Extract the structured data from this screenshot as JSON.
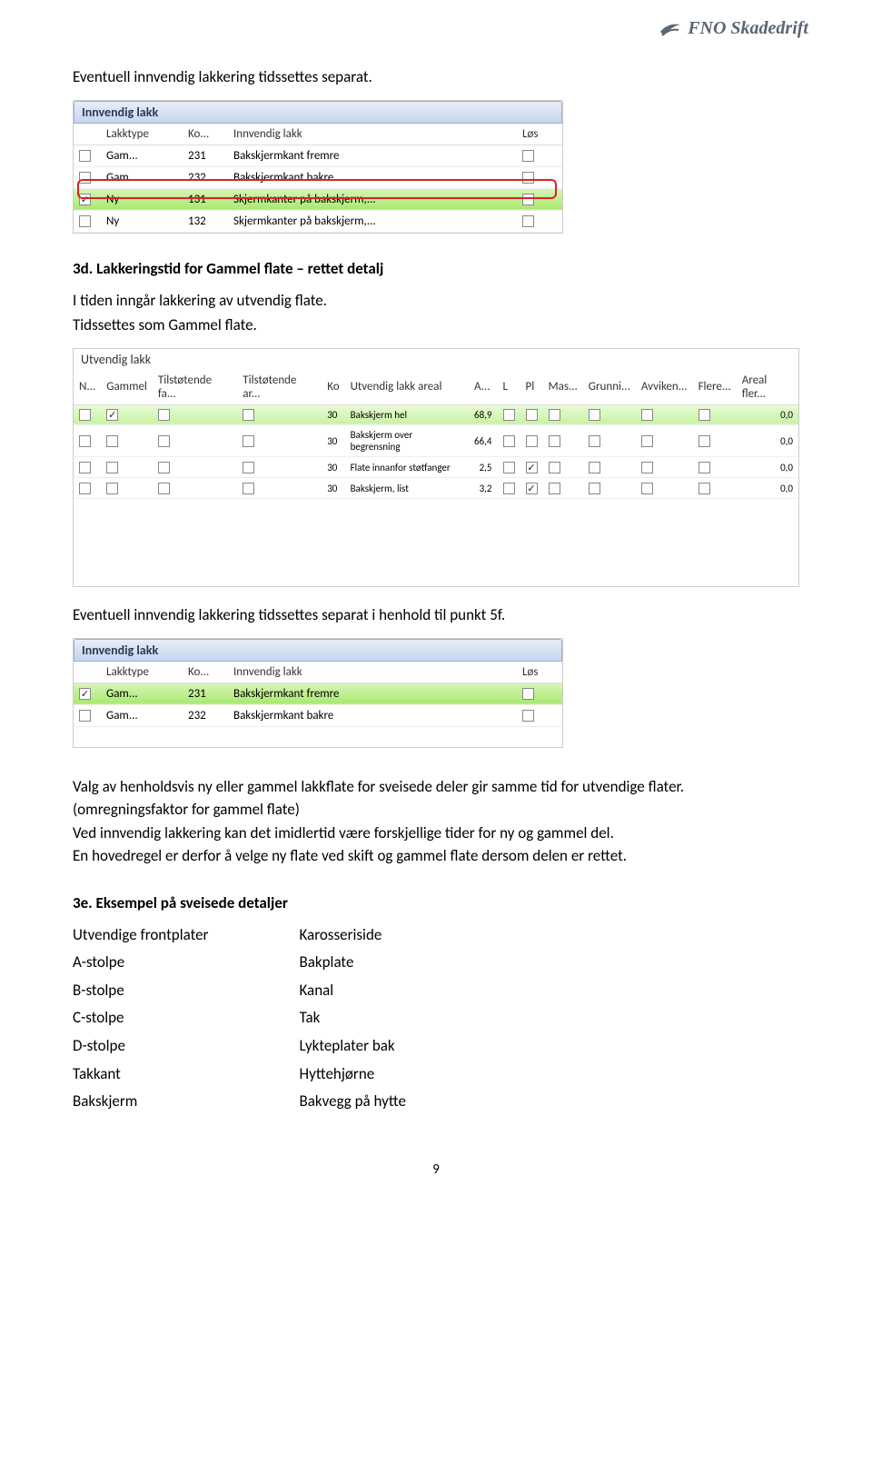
{
  "logo_text": "FNO Skadedrift",
  "intro": "Eventuell innvendig lakkering tidssettes separat.",
  "table1": {
    "title": "Innvendig lakk",
    "headers": [
      "",
      "Lakktype",
      "Ko...",
      "Innvendig lakk",
      "Løs"
    ],
    "rows": [
      {
        "chk": false,
        "type": "Gam...",
        "ko": "231",
        "desc": "Bakskjermkant fremre",
        "los": false,
        "green": false
      },
      {
        "chk": false,
        "type": "Gam...",
        "ko": "232",
        "desc": "Bakskjermkant bakre",
        "los": false,
        "green": false
      },
      {
        "chk": true,
        "type": "Ny",
        "ko": "131",
        "desc": "Skjermkanter på bakskjerm,...",
        "los": false,
        "green": true
      },
      {
        "chk": false,
        "type": "Ny",
        "ko": "132",
        "desc": "Skjermkanter på bakskjerm,...",
        "los": false,
        "green": false
      }
    ]
  },
  "section3d_title": "3d. Lakkeringstid for Gammel flate – rettet detalj",
  "section3d_para1": "I tiden inngår lakkering av utvendig flate.",
  "section3d_para2": "Tidssettes som Gammel flate.",
  "table2": {
    "title": "Utvendig lakk",
    "headers": [
      "N...",
      "Gammel",
      "Tilstøtende fa...",
      "Tilstøtende ar...",
      "Ko",
      "Utvendig lakk areal",
      "A...",
      "L",
      "Pl",
      "Mas...",
      "Grunni...",
      "Avviken...",
      "Flere...",
      "Areal fler..."
    ],
    "rows": [
      {
        "n": false,
        "g": true,
        "tf": false,
        "ta": false,
        "ko": "30",
        "desc": "Bakskjerm hel",
        "a": "68,9",
        "l": false,
        "pl": false,
        "mas": false,
        "gr": false,
        "av": false,
        "fl": false,
        "af": "0,0",
        "green": true
      },
      {
        "n": false,
        "g": false,
        "tf": false,
        "ta": false,
        "ko": "30",
        "desc": "Bakskjerm over begrensning",
        "a": "66,4",
        "l": false,
        "pl": false,
        "mas": false,
        "gr": false,
        "av": false,
        "fl": false,
        "af": "0,0",
        "green": false
      },
      {
        "n": false,
        "g": false,
        "tf": false,
        "ta": false,
        "ko": "30",
        "desc": "Flate innanfor støtfanger",
        "a": "2,5",
        "l": false,
        "pl": true,
        "mas": false,
        "gr": false,
        "av": false,
        "fl": false,
        "af": "0,0",
        "green": false
      },
      {
        "n": false,
        "g": false,
        "tf": false,
        "ta": false,
        "ko": "30",
        "desc": "Bakskjerm, list",
        "a": "3,2",
        "l": false,
        "pl": true,
        "mas": false,
        "gr": false,
        "av": false,
        "fl": false,
        "af": "0,0",
        "green": false
      }
    ]
  },
  "mid_para": "Eventuell innvendig lakkering tidssettes separat i henhold til punkt 5f.",
  "table3": {
    "title": "Innvendig lakk",
    "headers": [
      "",
      "Lakktype",
      "Ko...",
      "Innvendig lakk",
      "Løs"
    ],
    "rows": [
      {
        "chk": true,
        "type": "Gam...",
        "ko": "231",
        "desc": "Bakskjermkant fremre",
        "los": false,
        "green": true
      },
      {
        "chk": false,
        "type": "Gam...",
        "ko": "232",
        "desc": "Bakskjermkant bakre",
        "los": false,
        "green": false
      }
    ]
  },
  "para_valg": "Valg av henholdsvis ny eller gammel lakkflate for sveisede deler gir samme tid for utvendige flater. (omregningsfaktor for gammel flate)",
  "para_ved": "Ved innvendig lakkering kan det imidlertid være forskjellige tider for ny og gammel del.",
  "para_en": "En hovedregel er derfor å velge ny flate ved skift og gammel flate dersom delen er rettet.",
  "section3e_title": "3e. Eksempel på sveisede detaljer",
  "col1": [
    "Utvendige frontplater",
    "A-stolpe",
    "B-stolpe",
    "C-stolpe",
    "D-stolpe",
    "Takkant",
    "Bakskjerm"
  ],
  "col2": [
    "Karosseriside",
    "Bakplate",
    "Kanal",
    "Tak",
    "Lykteplater bak",
    "Hyttehjørne",
    "Bakvegg på hytte"
  ],
  "page_num": "9"
}
